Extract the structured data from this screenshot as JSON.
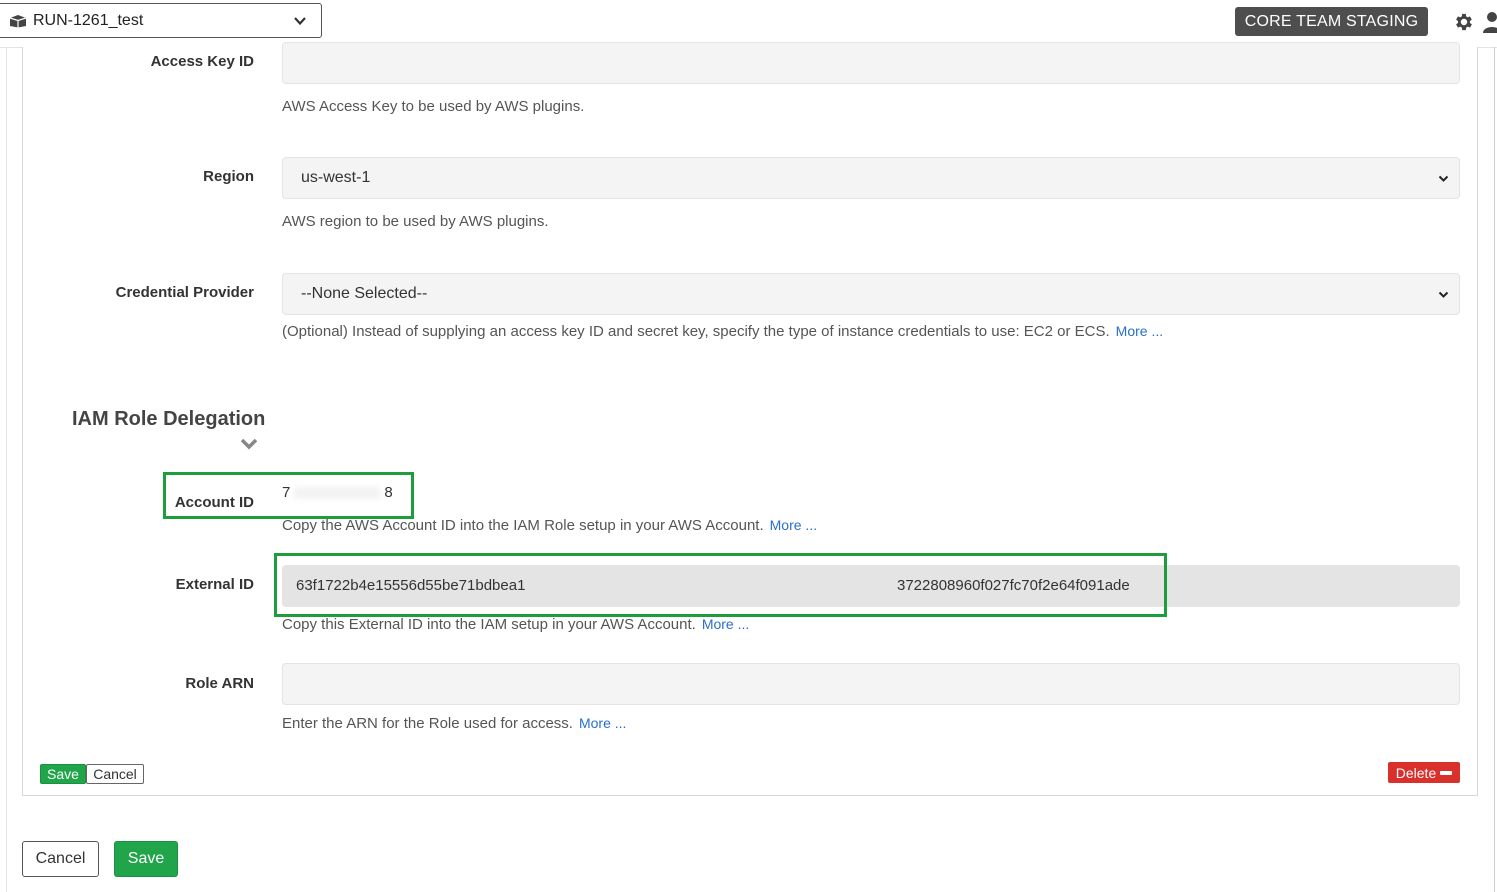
{
  "header": {
    "project_name": "RUN-1261_test",
    "environment_badge": "CORE TEAM STAGING",
    "project_icon": "box-icon",
    "settings_icon": "gear-icon",
    "user_icon": "user-icon"
  },
  "aws": {
    "access_key_label": "Access Key ID",
    "access_key_value": "",
    "access_key_help": "AWS Access Key to be used by AWS plugins.",
    "region_label": "Region",
    "region_value": "us-west-1",
    "region_help": "AWS region to be used by AWS plugins.",
    "credential_label": "Credential Provider",
    "credential_value": "--None Selected--",
    "credential_help": "(Optional) Instead of supplying an access key ID and secret key, specify the type of instance credentials to use: EC2 or ECS.",
    "credential_more": "More ..."
  },
  "iam": {
    "section_title": "IAM Role Delegation",
    "account_label": "Account ID",
    "account_prefix": "7",
    "account_suffix": "8",
    "account_help": "Copy the AWS Account ID into the IAM Role setup in your AWS Account.",
    "account_more": "More ...",
    "external_label": "External ID",
    "external_prefix": "63f1722b4e15556d55be71bdbea1",
    "external_suffix": "3722808960f027fc70f2e64f091ade",
    "external_help": "Copy this External ID into the IAM setup in your AWS Account.",
    "external_more": "More ...",
    "role_label": "Role ARN",
    "role_value": "",
    "role_help": "Enter the ARN for the Role used for access.",
    "role_more": "More ..."
  },
  "panel_buttons": {
    "save": "Save",
    "cancel": "Cancel",
    "delete": "Delete"
  },
  "footer_buttons": {
    "cancel": "Cancel",
    "save": "Save"
  },
  "colors": {
    "highlight": "#1e9e3a",
    "save_green": "#21a54a",
    "delete_red": "#d9302c",
    "link_blue": "#2a6fc9",
    "badge_gray": "#4e4e4e"
  }
}
